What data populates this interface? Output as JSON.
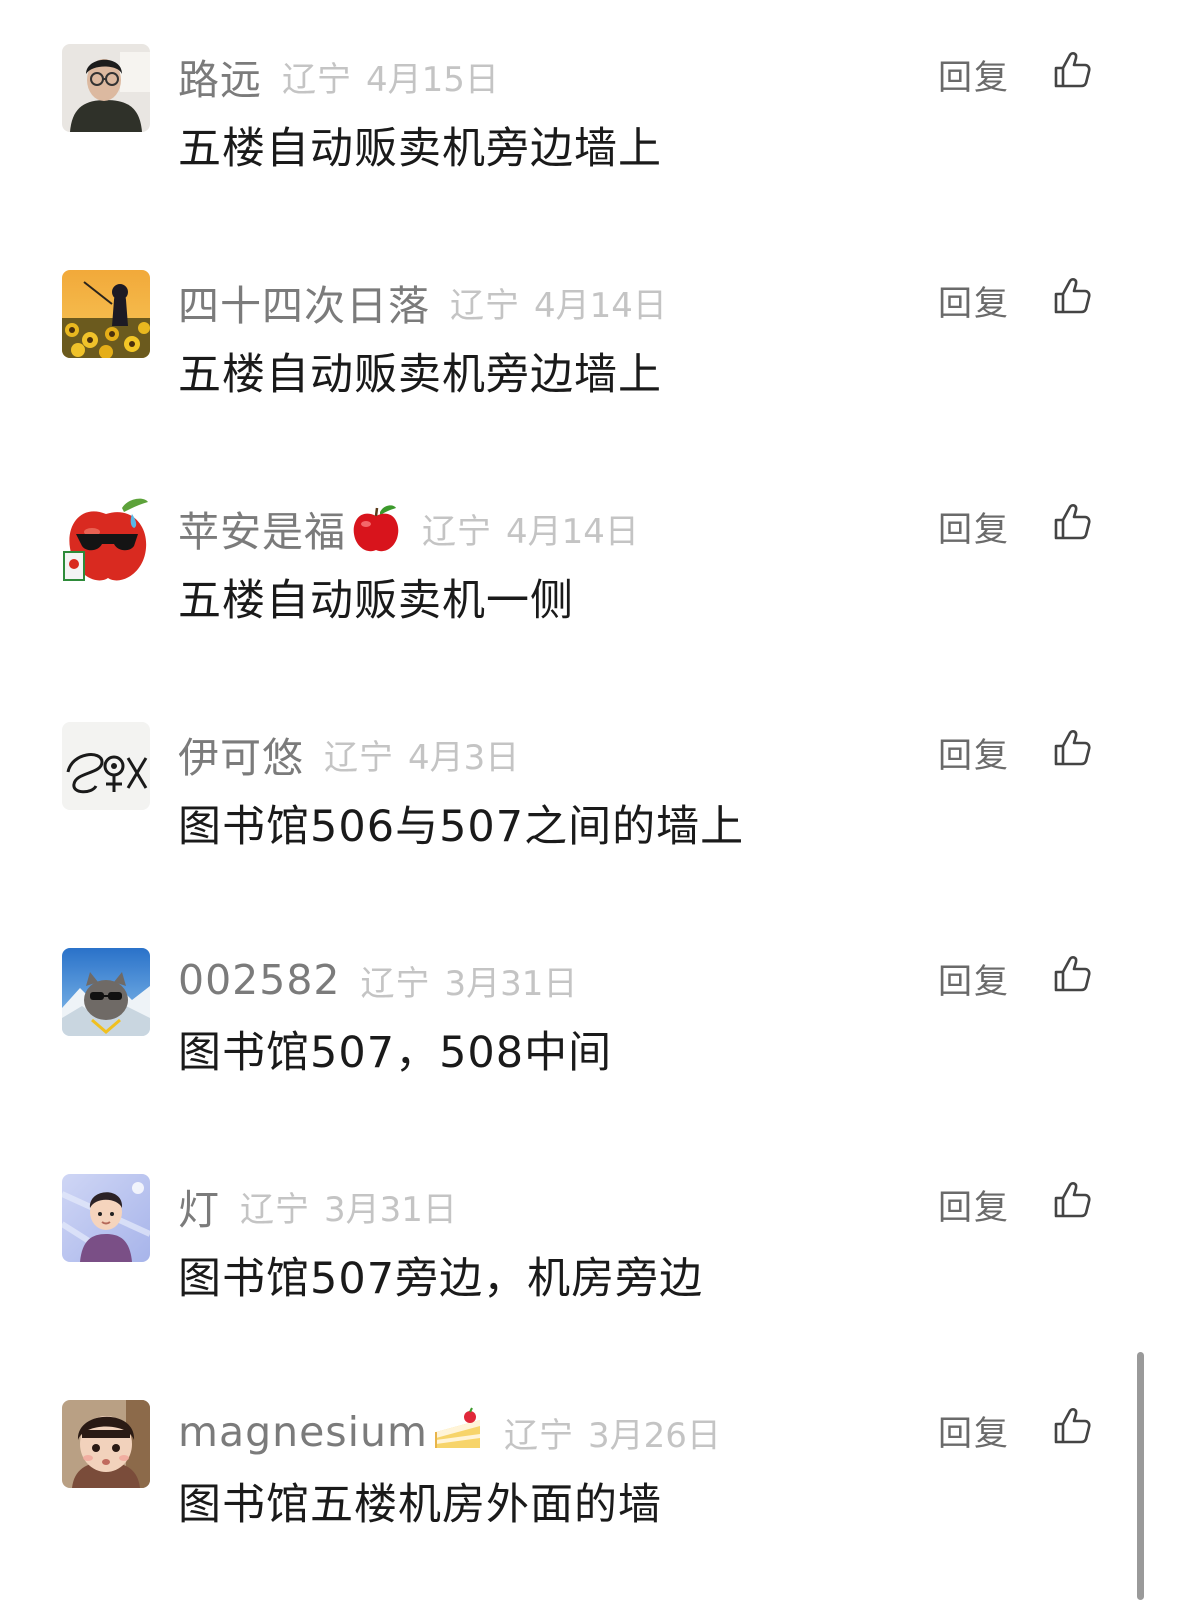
{
  "comments": [
    {
      "username": "路远",
      "region": "辽宁",
      "date": "4月15日",
      "content": "五楼自动贩卖机旁边墙上",
      "reply_label": "回复",
      "avatar": "photo-young-man-glasses"
    },
    {
      "username": "四十四次日落",
      "region": "辽宁",
      "date": "4月14日",
      "content": "五楼自动贩卖机旁边墙上",
      "reply_label": "回复",
      "avatar": "sunflower-field-figure"
    },
    {
      "username": "苹安是福",
      "username_emoji": "apple-emoji",
      "region": "辽宁",
      "date": "4月14日",
      "content": "五楼自动贩卖机一侧",
      "reply_label": "回复",
      "avatar": "apple-with-sunglasses"
    },
    {
      "username": "伊可悠",
      "region": "辽宁",
      "date": "4月3日",
      "content": "图书馆506与507之间的墙上",
      "reply_label": "回复",
      "avatar": "handwritten-sketch"
    },
    {
      "username": "002582",
      "region": "辽宁",
      "date": "3月31日",
      "content": "图书馆507，508中间",
      "reply_label": "回复",
      "avatar": "cat-on-snowy-mountain"
    },
    {
      "username": "灯",
      "region": "辽宁",
      "date": "3月31日",
      "content": "图书馆507旁边，机房旁边",
      "reply_label": "回复",
      "avatar": "cartoon-boy"
    },
    {
      "username": "magnesium",
      "username_emoji": "cake-emoji",
      "region": "辽宁",
      "date": "3月26日",
      "content": "图书馆五楼机房外面的墙",
      "reply_label": "回复",
      "avatar": "photo-toddler"
    }
  ],
  "like_icon": "thumbs-up-icon",
  "colors": {
    "username": "#7b7b7b",
    "meta": "#c4c4c4",
    "content": "#1a1a1a",
    "reply": "#6a6a6a"
  }
}
